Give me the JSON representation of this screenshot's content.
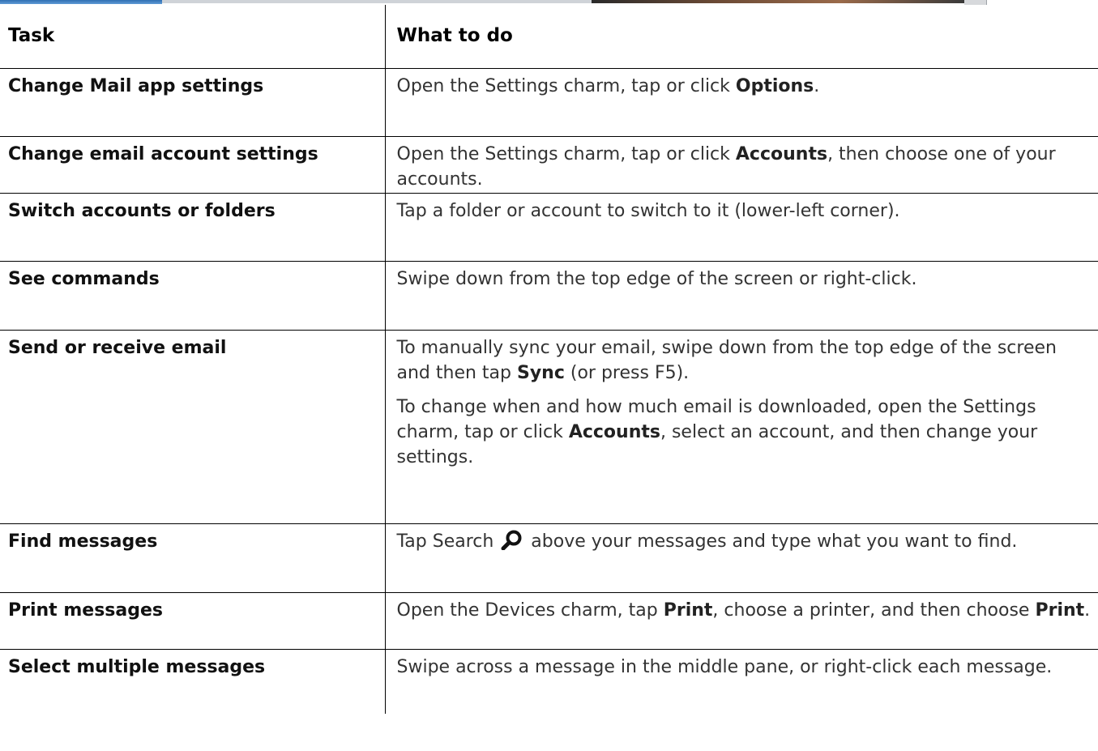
{
  "table": {
    "headers": {
      "task": "Task",
      "what_to_do": "What to do"
    },
    "rows": [
      {
        "task": "Change Mail app settings",
        "p1": {
          "t1": "Open the Settings charm, tap or click ",
          "b1": "Options",
          "t2": "."
        }
      },
      {
        "task": "Change email account settings",
        "p1": {
          "t1": "Open the Settings charm, tap or click ",
          "b1": "Accounts",
          "t2": ", then choose one of your accounts."
        }
      },
      {
        "task": "Switch accounts or folders",
        "p1": {
          "t1": "Tap a folder or account to switch to it (lower-left corner)."
        }
      },
      {
        "task": "See commands",
        "p1": {
          "t1": "Swipe down from the top edge of the screen or right-click."
        }
      },
      {
        "task": "Send or receive email",
        "p1": {
          "t1": "To manually sync your email, swipe down from the top edge of the screen and then tap ",
          "b1": "Sync",
          "t2": " (or press F5)."
        },
        "p2": {
          "t1": "To change when and how much email is downloaded, open the Settings charm, tap or click ",
          "b1": "Accounts",
          "t2": ", select an account, and then change your settings."
        }
      },
      {
        "task": "Find messages",
        "p1": {
          "t1": "Tap Search ",
          "icon": "search-icon",
          "t2": " above your messages and type what you want to find."
        }
      },
      {
        "task": "Print messages",
        "p1": {
          "t1": "Open the Devices charm, tap ",
          "b1": "Print",
          "t2": ", choose a printer, and then choose ",
          "b2": "Print",
          "t3": "."
        }
      },
      {
        "task": "Select multiple messages",
        "p1": {
          "t1": "Swipe across a message in the middle pane, or right-click each message."
        }
      }
    ]
  }
}
